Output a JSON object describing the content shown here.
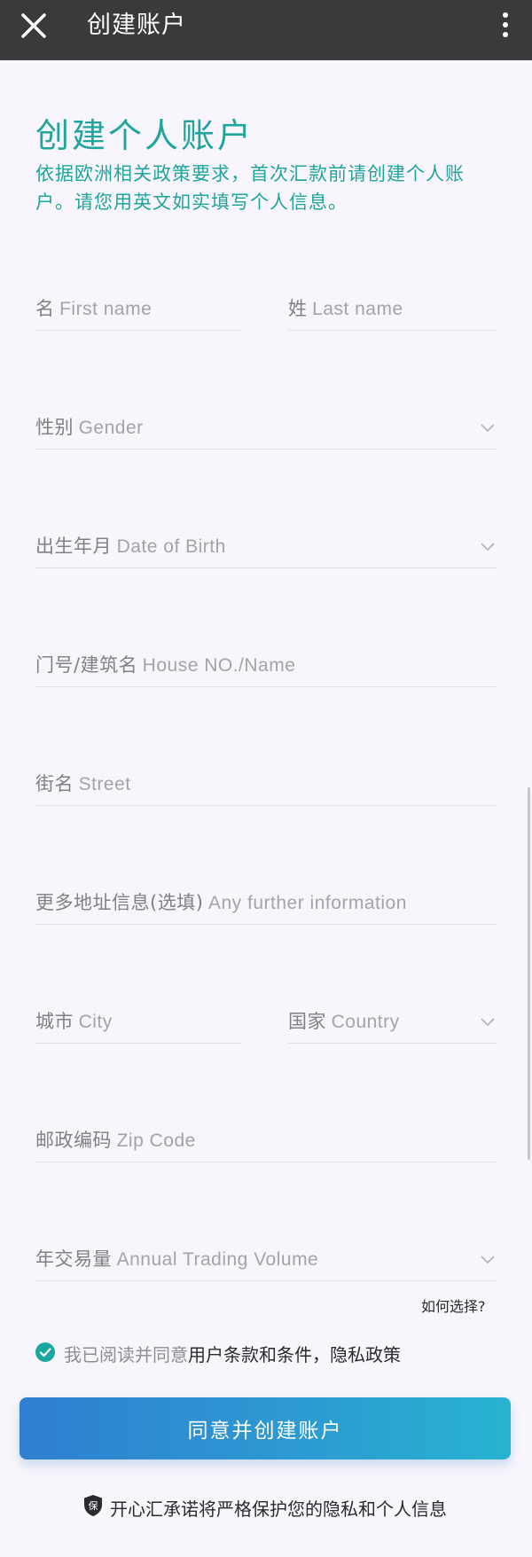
{
  "topbar": {
    "title": "创建账户",
    "close_icon": "close-icon",
    "more_icon": "more-vertical-icon"
  },
  "page": {
    "title": "创建个人账户",
    "description": "依据欧洲相关政策要求，首次汇款前请创建个人账户。请您用英文如实填写个人信息。"
  },
  "form": {
    "first_name": {
      "zh": "名",
      "en": "First name"
    },
    "last_name": {
      "zh": "姓",
      "en": "Last name"
    },
    "gender": {
      "zh": "性别",
      "en": "Gender"
    },
    "dob": {
      "zh": "出生年月",
      "en": "Date of Birth"
    },
    "house": {
      "zh": "门号/建筑名",
      "en": "House NO./Name"
    },
    "street": {
      "zh": "街名",
      "en": "Street"
    },
    "further": {
      "zh": "更多地址信息(选填)",
      "en": "Any further information"
    },
    "city": {
      "zh": "城市",
      "en": "City"
    },
    "country": {
      "zh": "国家",
      "en": "Country"
    },
    "zip": {
      "zh": "邮政编码",
      "en": "Zip Code"
    },
    "volume": {
      "zh": "年交易量",
      "en": "Annual Trading Volume"
    },
    "volume_hint": "如何选择?"
  },
  "agreement": {
    "checked": true,
    "prefix": "我已阅读并同意",
    "terms_link": "用户条款和条件",
    "separator": "，",
    "privacy_link": "隐私政策"
  },
  "submit_label": "同意并创建账户",
  "footer_note": "开心汇承诺将严格保护您的隐私和个人信息",
  "colors": {
    "accent": "#1fa59c",
    "button_start": "#2f7fd0",
    "button_end": "#27b3cf",
    "topbar": "#3a3a3c"
  }
}
